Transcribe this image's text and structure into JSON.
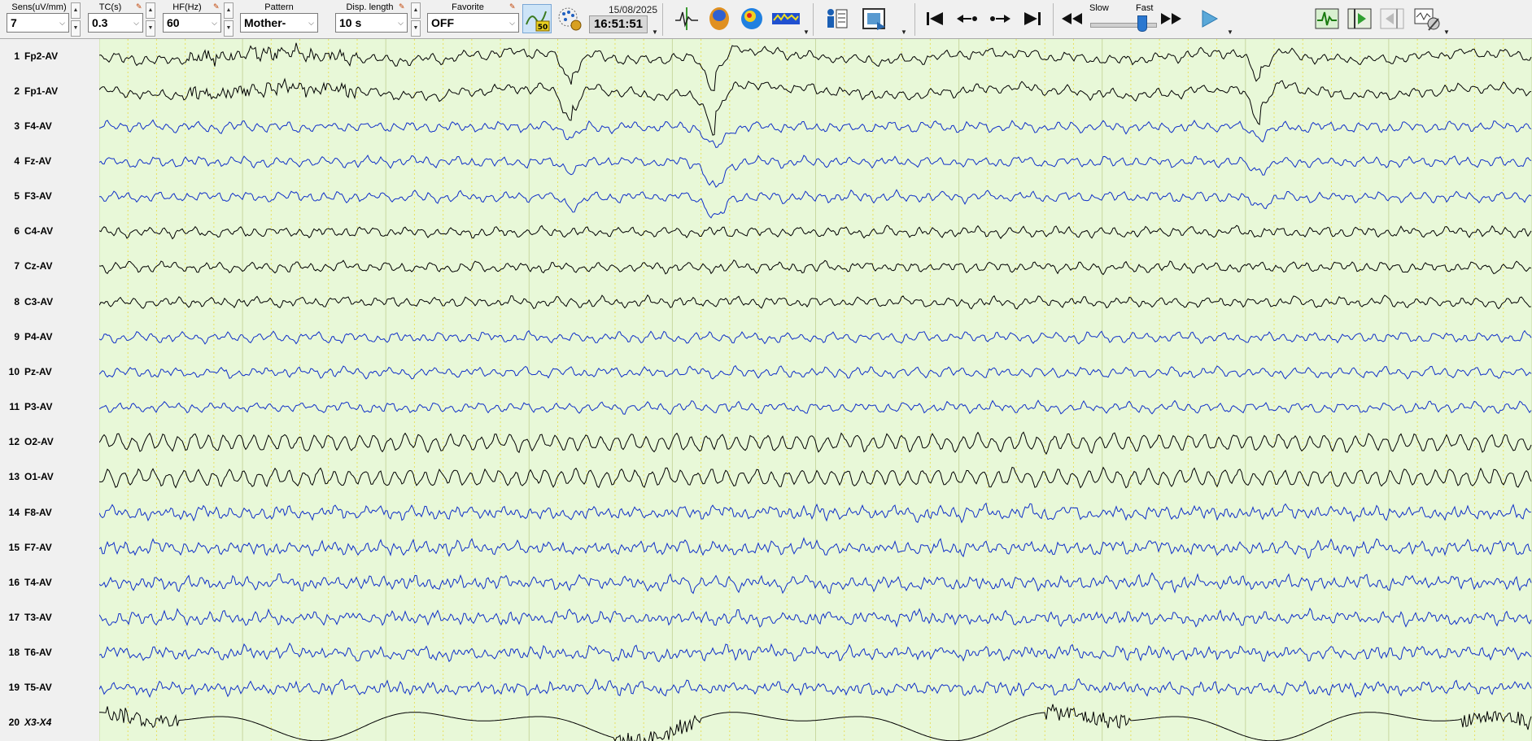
{
  "toolbar": {
    "sens": {
      "label": "Sens(uV/mm)",
      "value": "7"
    },
    "tc": {
      "label": "TC(s)",
      "value": "0.3"
    },
    "hf": {
      "label": "HF(Hz)",
      "value": "60"
    },
    "pattern": {
      "label": "Pattern",
      "value": "Mother-"
    },
    "disp_length": {
      "label": "Disp. length",
      "value": "10 s"
    },
    "favorite": {
      "label": "Favorite",
      "value": "OFF"
    },
    "date": "15/08/2025",
    "time": "16:51:51",
    "filter50_label": "50",
    "speed": {
      "slow_label": "Slow",
      "fast_label": "Fast",
      "level": 0.75
    }
  },
  "channels": [
    {
      "num": "1",
      "name": "Fp2-AV",
      "color": "#000000"
    },
    {
      "num": "2",
      "name": "Fp1-AV",
      "color": "#000000"
    },
    {
      "num": "3",
      "name": "F4-AV",
      "color": "#1030c8"
    },
    {
      "num": "4",
      "name": "Fz-AV",
      "color": "#1030c8"
    },
    {
      "num": "5",
      "name": "F3-AV",
      "color": "#1030c8"
    },
    {
      "num": "6",
      "name": "C4-AV",
      "color": "#000000"
    },
    {
      "num": "7",
      "name": "Cz-AV",
      "color": "#000000"
    },
    {
      "num": "8",
      "name": "C3-AV",
      "color": "#000000"
    },
    {
      "num": "9",
      "name": "P4-AV",
      "color": "#1030c8"
    },
    {
      "num": "10",
      "name": "Pz-AV",
      "color": "#1030c8"
    },
    {
      "num": "11",
      "name": "P3-AV",
      "color": "#1030c8"
    },
    {
      "num": "12",
      "name": "O2-AV",
      "color": "#000000"
    },
    {
      "num": "13",
      "name": "O1-AV",
      "color": "#000000"
    },
    {
      "num": "14",
      "name": "F8-AV",
      "color": "#1030c8"
    },
    {
      "num": "15",
      "name": "F7-AV",
      "color": "#1030c8"
    },
    {
      "num": "16",
      "name": "T4-AV",
      "color": "#1030c8"
    },
    {
      "num": "17",
      "name": "T3-AV",
      "color": "#1030c8"
    },
    {
      "num": "18",
      "name": "T6-AV",
      "color": "#1030c8"
    },
    {
      "num": "19",
      "name": "T5-AV",
      "color": "#1030c8"
    },
    {
      "num": "20",
      "name": "X3-X4",
      "color": "#000000",
      "italic": true
    }
  ],
  "colors": {
    "background": "#e8f8d8",
    "grid_second": "#c8d8a0",
    "grid_subdivision": "#e8e060"
  }
}
